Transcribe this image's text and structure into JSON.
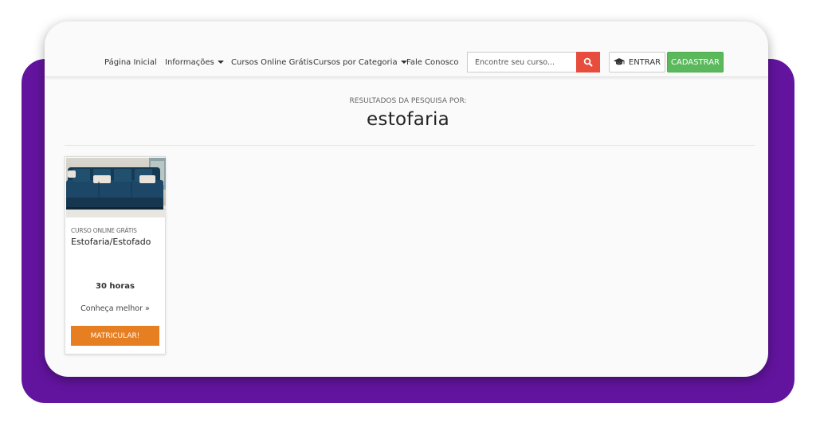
{
  "nav": {
    "items": [
      {
        "label": "Página Inicial"
      },
      {
        "label": "Informações"
      },
      {
        "label": "Cursos Online Grátis"
      },
      {
        "label": "Cursos por Categoria"
      },
      {
        "label": "Fale Conosco"
      }
    ],
    "search_placeholder": "Encontre seu curso...",
    "login_label": "ENTRAR",
    "signup_label": "CADASTRAR"
  },
  "results": {
    "label": "RESULTADOS DA PESQUISA POR:",
    "term": "estofaria"
  },
  "card": {
    "tag": "CURSO ONLINE GRÁTIS",
    "title": "Estofaria/Estofado",
    "hours": "30 horas",
    "more_label": "Conheça melhor »",
    "enroll_label": "MATRICULAR!"
  },
  "colors": {
    "background_accent": "#63149f",
    "search_button": "#e74c3c",
    "signup_button": "#5cb85c",
    "enroll_button": "#e67e22"
  }
}
